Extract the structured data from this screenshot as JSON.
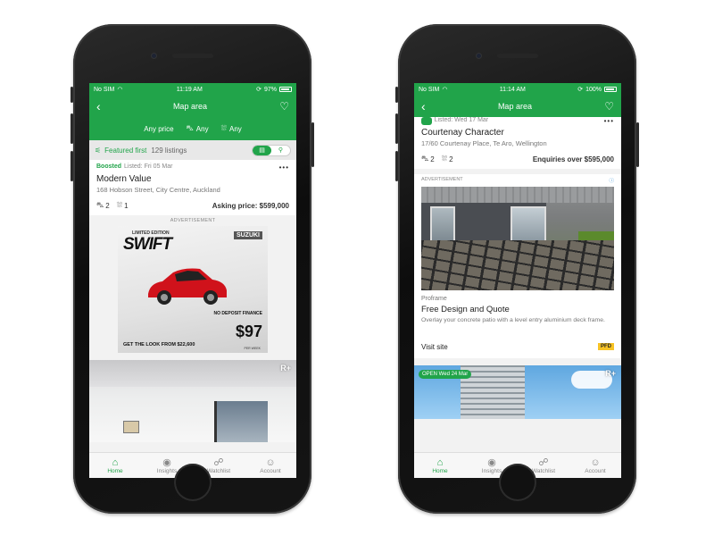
{
  "phones": [
    {
      "status": {
        "carrier": "No SIM",
        "time": "11:19 AM",
        "battery": "97%"
      },
      "nav": {
        "title": "Map area"
      },
      "filters": {
        "price": "Any price",
        "beds": "Any",
        "baths": "Any"
      },
      "featured": {
        "sort_label": "Featured first",
        "count": "129 listings"
      },
      "listing": {
        "badge": "Boosted",
        "listed": "Listed: Fri 05 Mar",
        "title": "Modern Value",
        "address": "168 Hobson Street, City Centre, Auckland",
        "beds": "2",
        "baths": "1",
        "price": "Asking price: $599,000"
      },
      "ad": {
        "label": "ADVERTISEMENT",
        "edition": "LIMITED EDITION",
        "model": "SWIFT",
        "brand": "SUZUKI",
        "offer": "NO DEPOSIT FINANCE",
        "from": "FROM",
        "amount": "$97",
        "per_week": "PER WEEK",
        "tagline": "GET THE LOOK FROM $22,600"
      }
    },
    {
      "status": {
        "carrier": "No SIM",
        "time": "11:14 AM",
        "battery": "100%"
      },
      "nav": {
        "title": "Map area"
      },
      "listing": {
        "listed": "Listed: Wed 17 Mar",
        "title": "Courtenay Character",
        "address": "17/60 Courtenay Place, Te Aro, Wellington",
        "beds": "2",
        "baths": "2",
        "price": "Enquiries over $595,000"
      },
      "ad": {
        "label": "ADVERTISEMENT",
        "provider": "Proframe",
        "title": "Free Design and Quote",
        "description": "Overlay your concrete patio with a level entry aluminium deck frame.",
        "cta": "Visit site",
        "logo_text": "PFD"
      },
      "next": {
        "open_badge": "OPEN Wed 24 Mar"
      }
    }
  ],
  "tabs": [
    {
      "label": "Home",
      "icon": "home-icon"
    },
    {
      "label": "Insights",
      "icon": "eye-icon"
    },
    {
      "label": "Watchlist",
      "icon": "binoculars-icon"
    },
    {
      "label": "Account",
      "icon": "account-icon"
    }
  ],
  "colors": {
    "brand_green": "#21a44a"
  }
}
